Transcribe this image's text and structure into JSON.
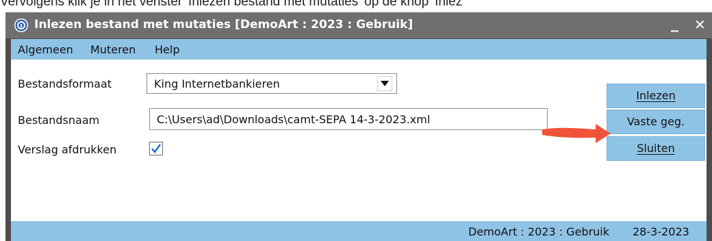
{
  "caption": "Vervolgens klik je in het venster 'Inlezen bestand met mutaties' op de knop 'Inlez",
  "window": {
    "title": "Inlezen bestand met mutaties  [DemoArt : 2023 : Gebruik]",
    "minimize_glyph": "_",
    "close_glyph": "✕",
    "icon": "app-icon"
  },
  "menu": {
    "items": [
      "Algemeen",
      "Muteren",
      "Help"
    ]
  },
  "form": {
    "format_label": "Bestandsformaat",
    "format_value": "King Internetbankieren",
    "filename_label": "Bestandsnaam",
    "filename_value": "C:\\Users\\ad\\Downloads\\camt-SEPA 14-3-2023.xml",
    "print_report_label": "Verslag afdrukken",
    "print_report_checked": true
  },
  "buttons": {
    "read": "Inlezen",
    "fixed_data": "Vaste geg.",
    "close": "Sluiten"
  },
  "annotation": {
    "arrow_color": "#f0533a"
  },
  "status": {
    "context": "DemoArt : 2023 : Gebruik",
    "date": "28-3-2023"
  },
  "colors": {
    "accent": "#8fc3e6",
    "titlebar": "#6f6f6f",
    "frame": "#4d4d4d"
  }
}
